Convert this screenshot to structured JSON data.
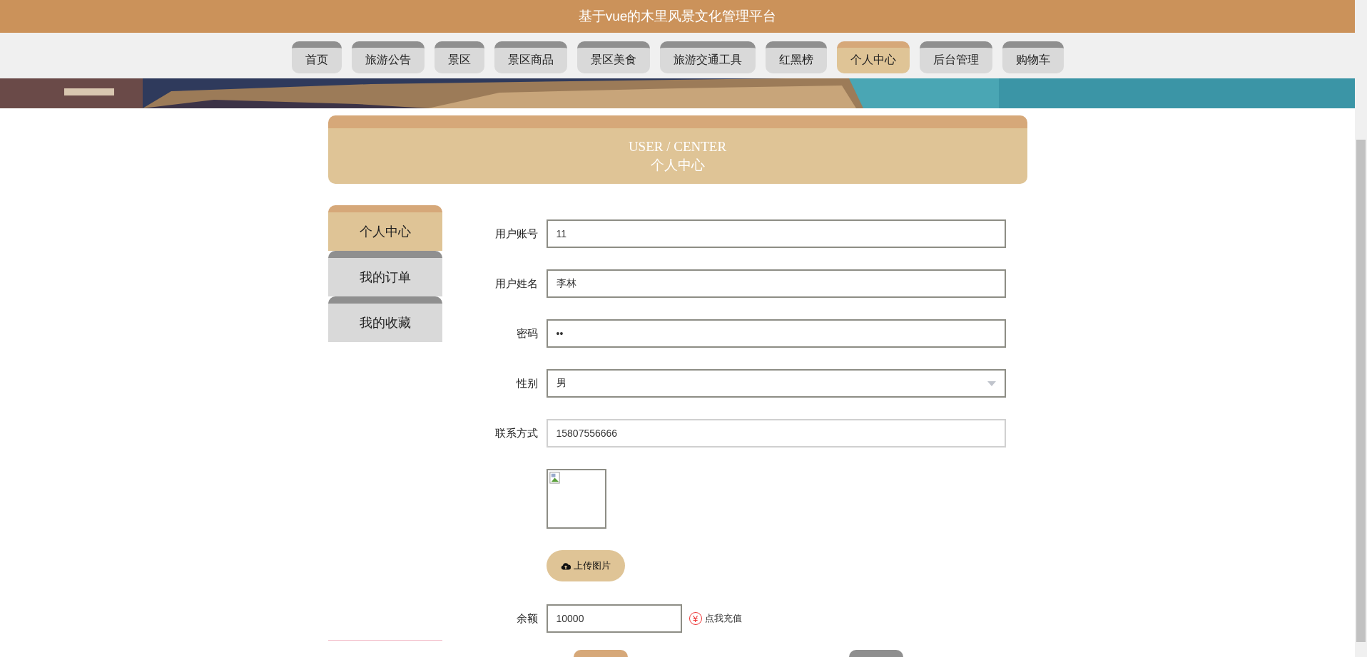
{
  "header": {
    "title": "基于vue的木里风景文化管理平台"
  },
  "nav": [
    {
      "label": "首页",
      "selected": false
    },
    {
      "label": "旅游公告",
      "selected": false
    },
    {
      "label": "景区",
      "selected": false
    },
    {
      "label": "景区商品",
      "selected": false
    },
    {
      "label": "景区美食",
      "selected": false
    },
    {
      "label": "旅游交通工具",
      "selected": false
    },
    {
      "label": "红黑榜",
      "selected": false
    },
    {
      "label": "个人中心",
      "selected": true
    },
    {
      "label": "后台管理",
      "selected": false
    },
    {
      "label": "购物车",
      "selected": false
    }
  ],
  "page_heading": {
    "english": "USER / CENTER",
    "title": "个人中心"
  },
  "sidebar": {
    "items": [
      {
        "label": "个人中心",
        "selected": true
      },
      {
        "label": "我的订单",
        "selected": false
      },
      {
        "label": "我的收藏",
        "selected": false
      }
    ]
  },
  "form": {
    "fields": [
      {
        "label": "用户账号",
        "kind": "text",
        "value": "11",
        "disabled": false
      },
      {
        "label": "用户姓名",
        "kind": "text",
        "value": "李林",
        "disabled": false
      },
      {
        "label": "密码",
        "kind": "text",
        "value": "••",
        "disabled": false
      },
      {
        "label": "性别",
        "kind": "select",
        "value": "男",
        "disabled": false
      },
      {
        "label": "联系方式",
        "kind": "text",
        "value": "15807556666",
        "disabled": true
      }
    ],
    "photo": {
      "kind": "broken-image"
    },
    "upload_button": "上传图片",
    "balance": {
      "label": "余额",
      "value": "10000"
    },
    "recharge": {
      "icon": "¥",
      "label": "点我充值"
    }
  }
}
